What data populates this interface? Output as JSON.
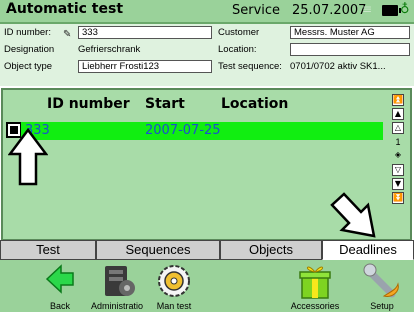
{
  "header": {
    "title": "Automatic test",
    "mode": "Service",
    "date": "25.07.2007"
  },
  "info": {
    "id_label": "ID number:",
    "id_value": "333",
    "designation_label": "Designation",
    "designation_value": "Gefrierschrank",
    "object_type_label": "Object type",
    "object_type_value": "Liebherr Frosti123",
    "customer_label": "Customer",
    "customer_value": "Messrs. Muster AG",
    "location_label": "Location:",
    "location_value": "",
    "test_sequence_label": "Test sequence:",
    "test_sequence_value": "0701/0702 aktiv SK1..."
  },
  "list": {
    "columns": [
      "ID number",
      "Start",
      "Location"
    ],
    "rows": [
      {
        "id": "333",
        "start": "2007-07-25",
        "location": ""
      }
    ],
    "page": "1"
  },
  "tabs": [
    "Test",
    "Sequences",
    "Objects",
    "Deadlines"
  ],
  "active_tab": "Deadlines",
  "toolbar": {
    "back": "Back",
    "administration": "Administratio",
    "man_test": "Man test",
    "accessories": "Accessories",
    "setup": "Setup"
  },
  "colors": {
    "header_bg": "#9ad29a",
    "info_bg": "#dff2df",
    "list_bg": "#a8dca8",
    "selected_row": "#11ee11",
    "row_text": "#1a4fd0"
  },
  "icons": [
    "pencil-icon",
    "battery-icon",
    "plug-icon",
    "back-arrow-icon",
    "administration-icon",
    "man-test-gear-icon",
    "accessories-gift-icon",
    "setup-wrench-icon"
  ]
}
